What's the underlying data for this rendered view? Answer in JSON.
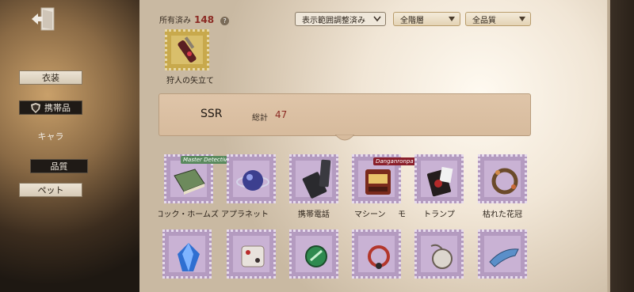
{
  "sidebar": {
    "items": [
      {
        "label": "衣装",
        "state": "normal"
      },
      {
        "label": "携帯品",
        "state": "selected"
      },
      {
        "label": "キャラ",
        "state": "plain"
      },
      {
        "label": "品質",
        "state": "selected-dark"
      },
      {
        "label": "ペット",
        "state": "normal"
      }
    ]
  },
  "header": {
    "owned_label": "所有済み",
    "owned_count": "148",
    "help_glyph": "?"
  },
  "filters": {
    "range": "表示範囲調整済み",
    "tier": "全階層",
    "quality": "全品質"
  },
  "top_item": {
    "label": "狩人の矢立て",
    "rarity_color": "#c8a94c"
  },
  "ssr_section": {
    "title": "SSR",
    "total_label": "総計",
    "total_value": "47"
  },
  "ssr_items_row1": [
    {
      "label": "ロック・ホームズ",
      "icon": "book-icon",
      "badge": "Master Detective"
    },
    {
      "label": "アプラネット",
      "icon": "planet-orb-icon",
      "badge": ""
    },
    {
      "label": "携帯電話",
      "icon": "flip-phone-icon",
      "badge": ""
    },
    {
      "label": "マシーン",
      "icon": "slot-machine-icon",
      "badge": "Danganronpa"
    },
    {
      "label": "トランプ",
      "icon": "card-deck-icon",
      "badge": ""
    },
    {
      "label": "枯れた花冠",
      "icon": "flower-wreath-icon",
      "badge": ""
    }
  ],
  "ssr_items_row2": [
    {
      "icon": "blue-crystal-icon"
    },
    {
      "icon": "dice-cube-icon"
    },
    {
      "icon": "green-gem-icon"
    },
    {
      "icon": "red-necklace-icon"
    },
    {
      "icon": "pocket-watch-icon"
    },
    {
      "icon": "blue-fish-icon"
    }
  ],
  "partial_label": "モ"
}
